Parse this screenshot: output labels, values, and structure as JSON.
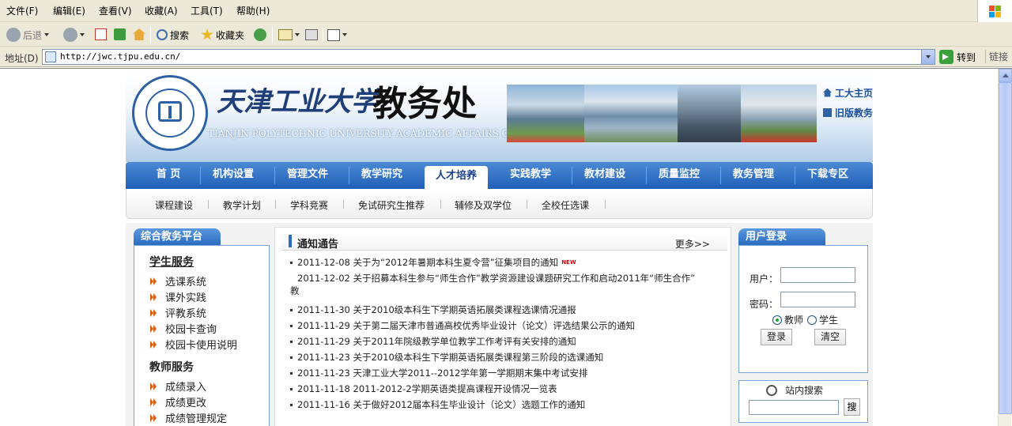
{
  "browser": {
    "menu": [
      "文件(F)",
      "编辑(E)",
      "查看(V)",
      "收藏(A)",
      "工具(T)",
      "帮助(H)"
    ],
    "toolbar": {
      "back": "后退",
      "search": "搜索",
      "favorites": "收藏夹"
    },
    "address_label": "地址(D)",
    "url": "http://jwc.tjpu.edu.cn/",
    "go": "转到",
    "links": "链接",
    "colors": {
      "chrome": "#ece9d8",
      "addr_border": "#7f9db9"
    }
  },
  "site": {
    "banner": {
      "school_name": "天津工业大学",
      "office_name": "教务处",
      "english_name": "TIANJIN POLYTECHNIC UNIVERSITY ACADEMIC AFFAIRS OFFICE",
      "top_links": [
        "工大主页",
        "旧版教务"
      ]
    },
    "nav": {
      "items": [
        "首  页",
        "机构设置",
        "管理文件",
        "教学研究",
        "人才培养",
        "实践教学",
        "教材建设",
        "质量监控",
        "教务管理",
        "下载专区"
      ],
      "active": "人才培养"
    },
    "subnav": [
      "课程建设",
      "教学计划",
      "学科竞赛",
      "免试研究生推荐",
      "辅修及双学位",
      "全校任选课"
    ],
    "platform": {
      "title": "综合教务平台",
      "student_title": "学生服务",
      "student_links": [
        "选课系统",
        "课外实践",
        "评教系统",
        "校园卡查询",
        "校园卡使用说明"
      ],
      "teacher_title": "教师服务",
      "teacher_links": [
        "成绩录入",
        "成绩更改",
        "成绩管理规定"
      ]
    },
    "notices": {
      "title": "通知通告",
      "more": "更多>>",
      "new_badge": "NEW",
      "items": [
        {
          "date": "2011-12-08",
          "text": "关于为“2012年暑期本科生夏令营”征集项目的通知"
        },
        {
          "date": "2011-12-02",
          "text": "关于招募本科生参与“师生合作”教学资源建设课题研究工作和启动2011年“师生合作”",
          "wrap": "教"
        },
        {
          "date": "2011-11-30",
          "text": "关于2010级本科生下学期英语拓展类课程选课情况通报"
        },
        {
          "date": "2011-11-29",
          "text": "关于第二届天津市普通高校优秀毕业设计（论文）评选结果公示的通知"
        },
        {
          "date": "2011-11-29",
          "text": "关于2011年院级教学单位教学工作考评有关安排的通知"
        },
        {
          "date": "2011-11-23",
          "text": "关于2010级本科生下学期英语拓展类课程第三阶段的选课通知"
        },
        {
          "date": "2011-11-23",
          "text": "天津工业大学2011--2012学年第一学期期末集中考试安排"
        },
        {
          "date": "2011-11-18",
          "text": "2011-2012-2学期英语类提高课程开设情况一览表"
        },
        {
          "date": "2011-11-16",
          "text": "关于做好2012届本科生毕业设计（论文）选题工作的通知"
        }
      ]
    },
    "login": {
      "title": "用户登录",
      "user_label": "用户：",
      "password_label": "密码：",
      "role_teacher": "教师",
      "role_student": "学生",
      "selected_role": "教师",
      "login_button": "登录",
      "clear_button": "清空"
    },
    "search": {
      "title": "站内搜索",
      "button": "搜"
    },
    "colors": {
      "nav_top": "#4c8ad6",
      "nav_bottom": "#1f5fb7",
      "arrow": "#d85f12",
      "link": "#1a4fa0"
    }
  }
}
